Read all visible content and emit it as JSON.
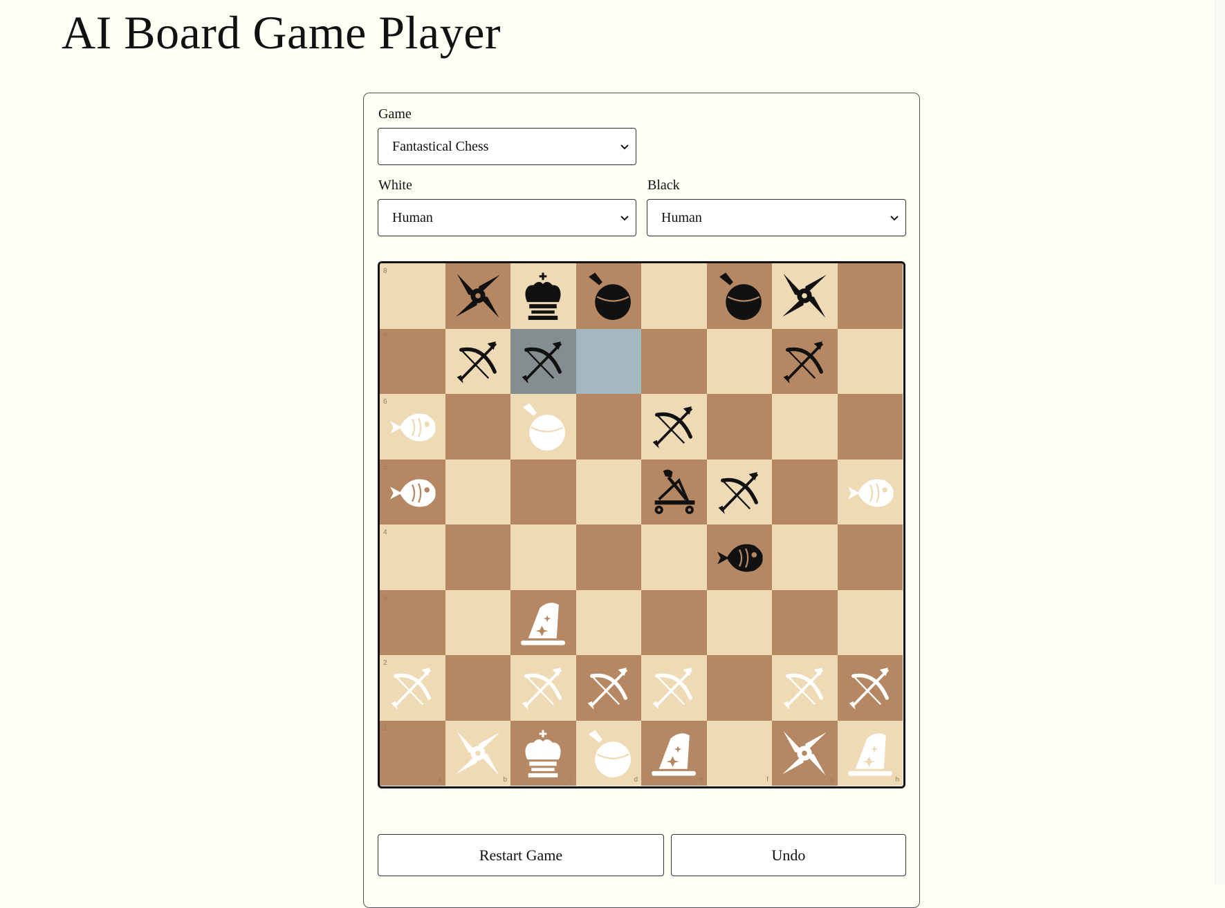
{
  "page": {
    "title": "AI Board Game Player"
  },
  "controls": {
    "game_label": "Game",
    "game_value": "Fantastical Chess",
    "white_label": "White",
    "white_value": "Human",
    "black_label": "Black",
    "black_value": "Human"
  },
  "board": {
    "files": [
      "a",
      "b",
      "c",
      "d",
      "e",
      "f",
      "g",
      "h"
    ],
    "ranks": [
      "8",
      "7",
      "6",
      "5",
      "4",
      "3",
      "2",
      "1"
    ],
    "selected_squares": [
      "c7",
      "d7"
    ],
    "colors": {
      "light_square": "#efdab6",
      "dark_square": "#b58863",
      "highlight_dark": "#858e8e",
      "highlight_light": "#a3b9bf",
      "white_piece": "#ffffff",
      "black_piece": "#111111"
    },
    "pieces": [
      {
        "square": "b8",
        "color": "black",
        "icon": "shuriken-icon"
      },
      {
        "square": "c8",
        "color": "black",
        "icon": "king-crown-icon"
      },
      {
        "square": "d8",
        "color": "black",
        "icon": "potion-icon"
      },
      {
        "square": "f8",
        "color": "black",
        "icon": "potion-icon"
      },
      {
        "square": "g8",
        "color": "black",
        "icon": "shuriken-icon"
      },
      {
        "square": "b7",
        "color": "black",
        "icon": "bow-arrow-icon"
      },
      {
        "square": "c7",
        "color": "black",
        "icon": "bow-arrow-icon"
      },
      {
        "square": "g7",
        "color": "black",
        "icon": "bow-arrow-icon"
      },
      {
        "square": "a6",
        "color": "white",
        "icon": "fish-icon"
      },
      {
        "square": "c6",
        "color": "white",
        "icon": "potion-icon"
      },
      {
        "square": "e6",
        "color": "black",
        "icon": "bow-arrow-icon"
      },
      {
        "square": "a5",
        "color": "white",
        "icon": "fish-icon"
      },
      {
        "square": "e5",
        "color": "black",
        "icon": "catapult-icon"
      },
      {
        "square": "f5",
        "color": "black",
        "icon": "bow-arrow-icon"
      },
      {
        "square": "h5",
        "color": "white",
        "icon": "fish-icon"
      },
      {
        "square": "f4",
        "color": "black",
        "icon": "fish-icon"
      },
      {
        "square": "c3",
        "color": "white",
        "icon": "wizard-hat-icon"
      },
      {
        "square": "a2",
        "color": "white",
        "icon": "bow-arrow-icon"
      },
      {
        "square": "c2",
        "color": "white",
        "icon": "bow-arrow-icon"
      },
      {
        "square": "d2",
        "color": "white",
        "icon": "bow-arrow-icon"
      },
      {
        "square": "e2",
        "color": "white",
        "icon": "bow-arrow-icon"
      },
      {
        "square": "g2",
        "color": "white",
        "icon": "bow-arrow-icon"
      },
      {
        "square": "h2",
        "color": "white",
        "icon": "bow-arrow-icon"
      },
      {
        "square": "b1",
        "color": "white",
        "icon": "shuriken-icon"
      },
      {
        "square": "c1",
        "color": "white",
        "icon": "king-crown-icon"
      },
      {
        "square": "d1",
        "color": "white",
        "icon": "potion-icon"
      },
      {
        "square": "e1",
        "color": "white",
        "icon": "wizard-hat-icon"
      },
      {
        "square": "g1",
        "color": "white",
        "icon": "shuriken-icon"
      },
      {
        "square": "h1",
        "color": "white",
        "icon": "wizard-hat-icon"
      }
    ]
  },
  "actions": {
    "restart_label": "Restart Game",
    "undo_label": "Undo"
  }
}
